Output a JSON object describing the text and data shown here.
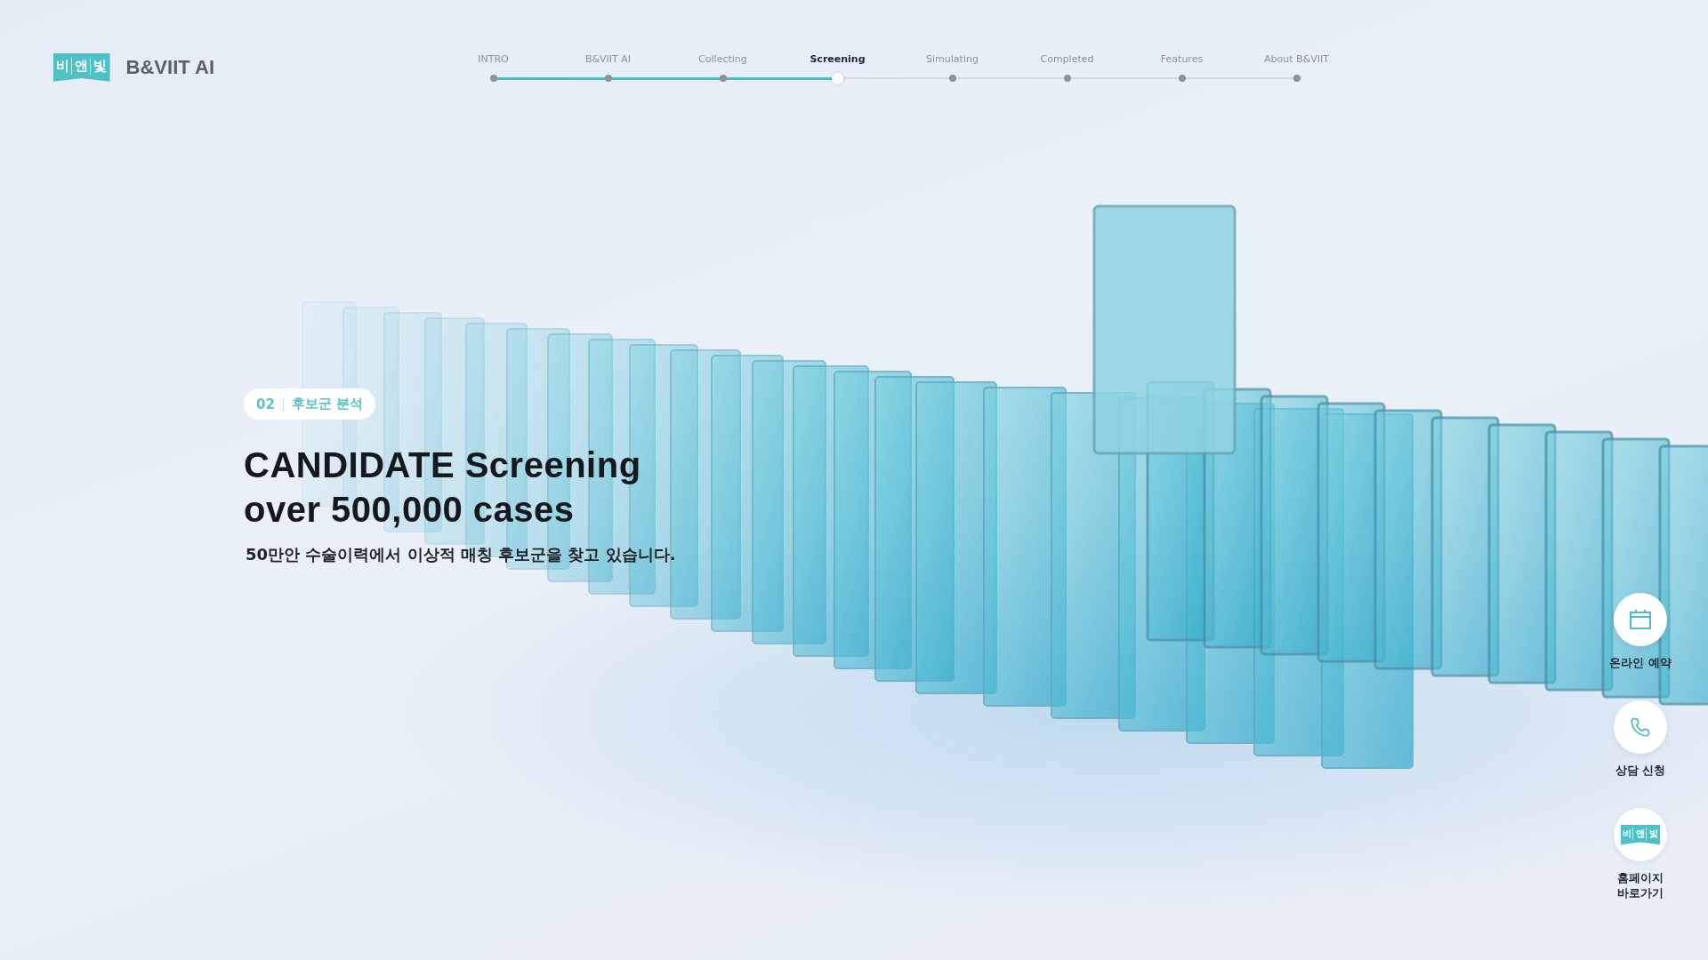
{
  "logo": {
    "mark": [
      "비",
      "앤",
      "빛"
    ],
    "name": "B&VIIT AI"
  },
  "steps": [
    {
      "label": "INTRO",
      "selected": false,
      "done": true
    },
    {
      "label": "B&VIIT AI",
      "selected": false,
      "done": true
    },
    {
      "label": "Collecting",
      "selected": false,
      "done": true
    },
    {
      "label": "Screening",
      "selected": true,
      "done": false
    },
    {
      "label": "Simulating",
      "selected": false,
      "done": false
    },
    {
      "label": "Completed",
      "selected": false,
      "done": false
    },
    {
      "label": "Features",
      "selected": false,
      "done": false
    },
    {
      "label": "About B&VIIT",
      "selected": false
    }
  ],
  "hero": {
    "badge_number": "02",
    "badge_label": "후보군 분석",
    "headline": [
      "CANDIDATE Screening",
      "over 500,000 cases"
    ],
    "subtitle": "50만안 수술이력에서 이상적 매칭 후보군을 찾고 있습니다."
  },
  "side_actions": [
    {
      "kind": "calendar",
      "label": [
        "온라인 예약"
      ]
    },
    {
      "kind": "phone",
      "label": [
        "상담 신청"
      ]
    },
    {
      "kind": "logo",
      "mark": [
        "비",
        "앤",
        "빛"
      ],
      "label": [
        "홈페이지",
        "바로가기"
      ]
    }
  ]
}
